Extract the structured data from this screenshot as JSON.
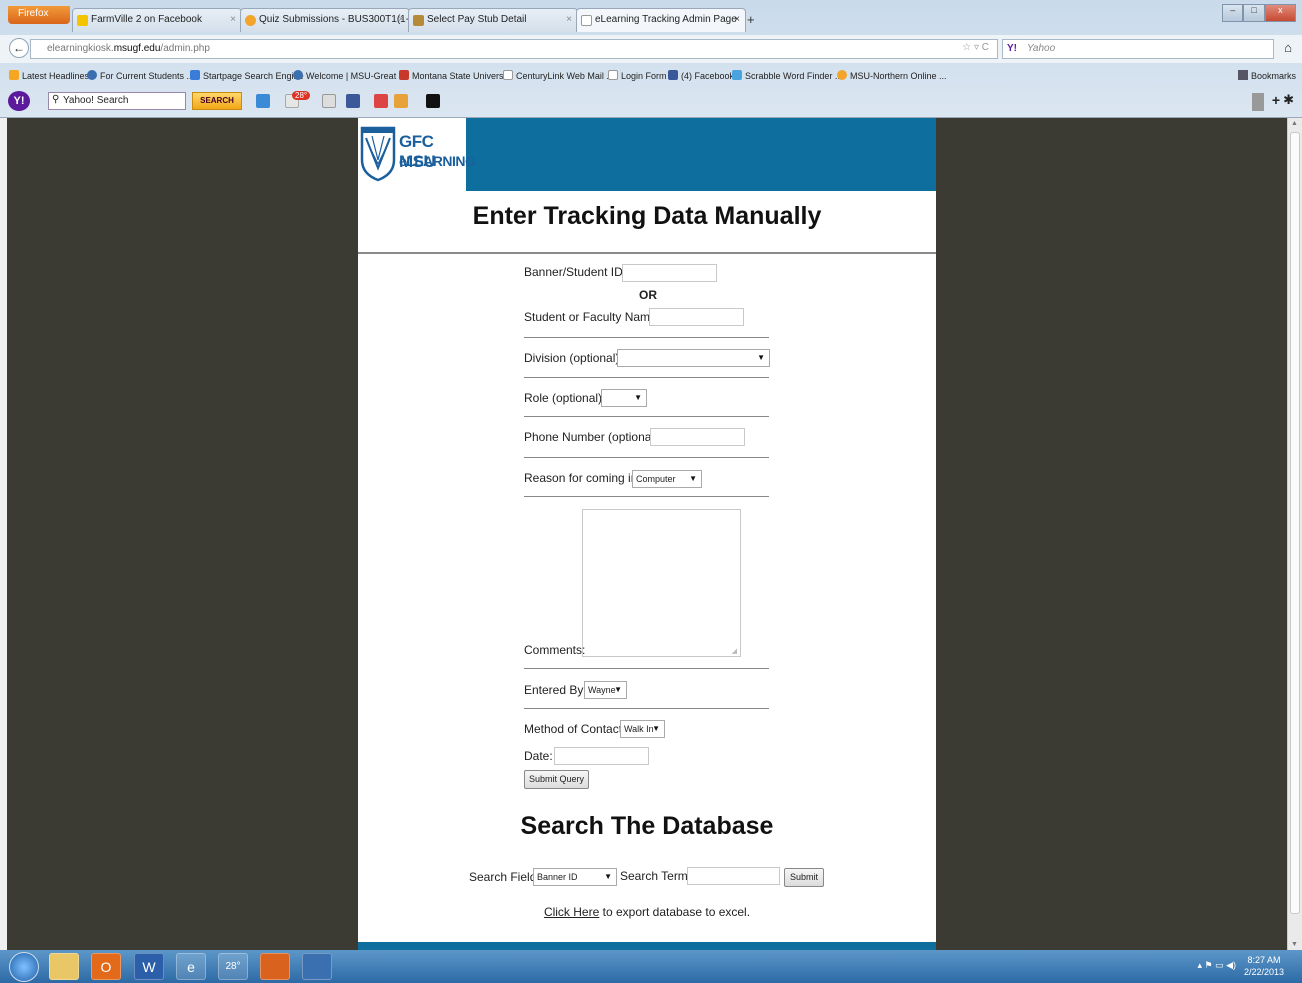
{
  "browser": {
    "menu_button": "Firefox",
    "tabs": [
      {
        "label": "FarmVille 2 on Facebook",
        "active": false
      },
      {
        "label": "Quiz Submissions - BUS300T1(1-5) - ...",
        "active": false
      },
      {
        "label": "Select Pay Stub Detail",
        "active": false
      },
      {
        "label": "eLearning Tracking Admin Page",
        "active": true
      }
    ],
    "url_domain": "elearningkiosk.",
    "url_host": "msugf.edu",
    "url_path": "/admin.php",
    "search_engine_placeholder": "Yahoo",
    "bookmarks": [
      "Latest Headlines",
      "For Current Students ...",
      "Startpage Search Engine",
      "Welcome | MSU-Great ...",
      "Montana State Univers...",
      "CenturyLink Web Mail ...",
      "Login Form",
      "(4) Facebook",
      "Scrabble Word Finder ...",
      "MSU-Northern Online ..."
    ],
    "bookmarks_menu": "Bookmarks",
    "toolbar_search_value": "Yahoo! Search",
    "toolbar_search_button": "SEARCH",
    "toolbar_badge": "28°"
  },
  "header": {
    "logo_line1": "GFC MSU",
    "logo_line2": "eLEARNING"
  },
  "form": {
    "title": "Enter Tracking Data Manually",
    "banner_id_label": "Banner/Student ID:",
    "or_label": "OR",
    "name_label": "Student or Faculty Name:",
    "division_label": "Division (optional):",
    "division_value": "",
    "role_label": "Role (optional):",
    "role_value": "",
    "phone_label": "Phone Number (optional):",
    "reason_label": "Reason for coming in:",
    "reason_value": "Computer",
    "comments_label": "Comments:",
    "entered_by_label": "Entered By:",
    "entered_by_value": "Wayne",
    "method_label": "Method of Contact:",
    "method_value": "Walk In",
    "date_label": "Date:",
    "submit_label": "Submit Query"
  },
  "search": {
    "title": "Search The Database",
    "field_label": "Search Field:",
    "field_value": "Banner ID",
    "term_label": "Search Term:",
    "submit_label": "Submit",
    "export_link": "Click Here",
    "export_text": "to export database to excel."
  },
  "taskbar": {
    "time": "8:27 AM",
    "date": "2/22/2013",
    "weather": "28°"
  }
}
